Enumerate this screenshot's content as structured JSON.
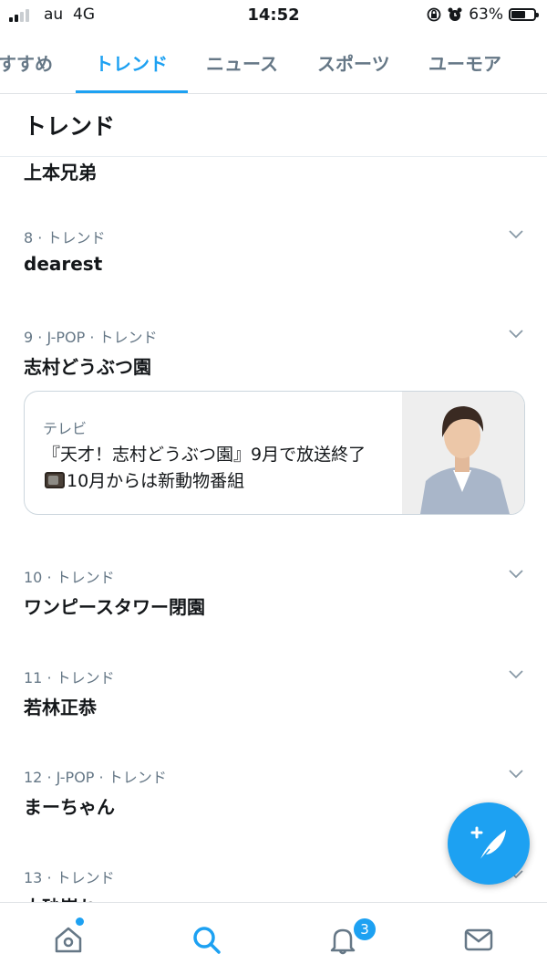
{
  "status_bar": {
    "carrier": "au",
    "network": "4G",
    "time": "14:52",
    "battery": "63%",
    "battery_level": 0.63,
    "icons": [
      "signal-icon",
      "rotation-lock-icon",
      "alarm-icon",
      "battery-icon"
    ]
  },
  "tabs": [
    "すすめ",
    "トレンド",
    "ニュース",
    "スポーツ",
    "ユーモア"
  ],
  "active_tab": "トレンド",
  "header": {
    "title": "トレンド"
  },
  "partial_item": {
    "name": "上本兄弟"
  },
  "trends": [
    {
      "meta": "8 · トレンド",
      "name": "dearest"
    },
    {
      "meta": "9 · J-POP · トレンド",
      "name": "志村どうぶつ園",
      "card": {
        "category": "テレビ",
        "text_before": "『天才！志村どうぶつ園』9月で放送終了",
        "icon": "television-emoji",
        "text_after": "10月からは新動物番組"
      }
    },
    {
      "meta": "10 · トレンド",
      "name": "ワンピースタワー閉園"
    },
    {
      "meta": "11 · トレンド",
      "name": "若林正恭"
    },
    {
      "meta": "12 · J-POP · トレンド",
      "name": "まーちゃん"
    },
    {
      "meta": "13 · トレンド",
      "name": "大砂嵐ね"
    }
  ],
  "fab": {
    "icon": "compose-tweet-icon"
  },
  "bottom_nav": {
    "items": [
      "home-icon",
      "search-icon",
      "notifications-icon",
      "messages-icon"
    ],
    "notification_count": "3",
    "active": "search-icon"
  },
  "colors": {
    "accent": "#1da1f2",
    "text": "#14171a",
    "secondary": "#657786",
    "border": "#dfe3e6"
  }
}
